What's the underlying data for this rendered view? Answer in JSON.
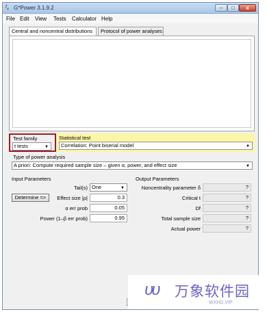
{
  "window": {
    "title": "G*Power 3.1.9.2",
    "app_icon": "graph-icon"
  },
  "controls": {
    "minimize": "–",
    "maximize": "□",
    "close": "x"
  },
  "menu": [
    "File",
    "Edit",
    "View",
    "Tests",
    "Calculator",
    "Help"
  ],
  "tabs": [
    {
      "label": "Central and noncentral distributions",
      "active": true
    },
    {
      "label": "Protocol of power analyses",
      "active": false
    }
  ],
  "test_family": {
    "label": "Test family",
    "value": "t tests"
  },
  "statistical_test": {
    "label": "Statistical test",
    "value": "Correlation: Point biserial model",
    "highlight": "#fbf6a6"
  },
  "power_analysis": {
    "label": "Type of power analysis",
    "value": "A priori: Compute required sample size – given α, power, and effect size"
  },
  "input": {
    "section": "Input Parameters",
    "tails_label": "Tail(s)",
    "tails_value": "One",
    "determine_label": "Determine =>",
    "effect_label": "Effect size |ρ|",
    "effect_value": "0.3",
    "alpha_label": "α err prob",
    "alpha_value": "0.05",
    "power_label": "Power (1–β err prob)",
    "power_value": "0.95"
  },
  "output": {
    "section": "Output Parameters",
    "ncp_label": "Noncentrality parameter δ",
    "ncp_value": "?",
    "critical_label": "Critical t",
    "critical_value": "?",
    "df_label": "Df",
    "df_value": "?",
    "total_label": "Total sample size",
    "total_value": "?",
    "actual_label": "Actual power",
    "actual_value": "?"
  },
  "watermark": {
    "logo": "υυ",
    "text": "万象软件园",
    "url": "WXHD.VIP"
  },
  "colors": {
    "family_border": "#9a1f24",
    "watermark": "#6b63c9"
  }
}
